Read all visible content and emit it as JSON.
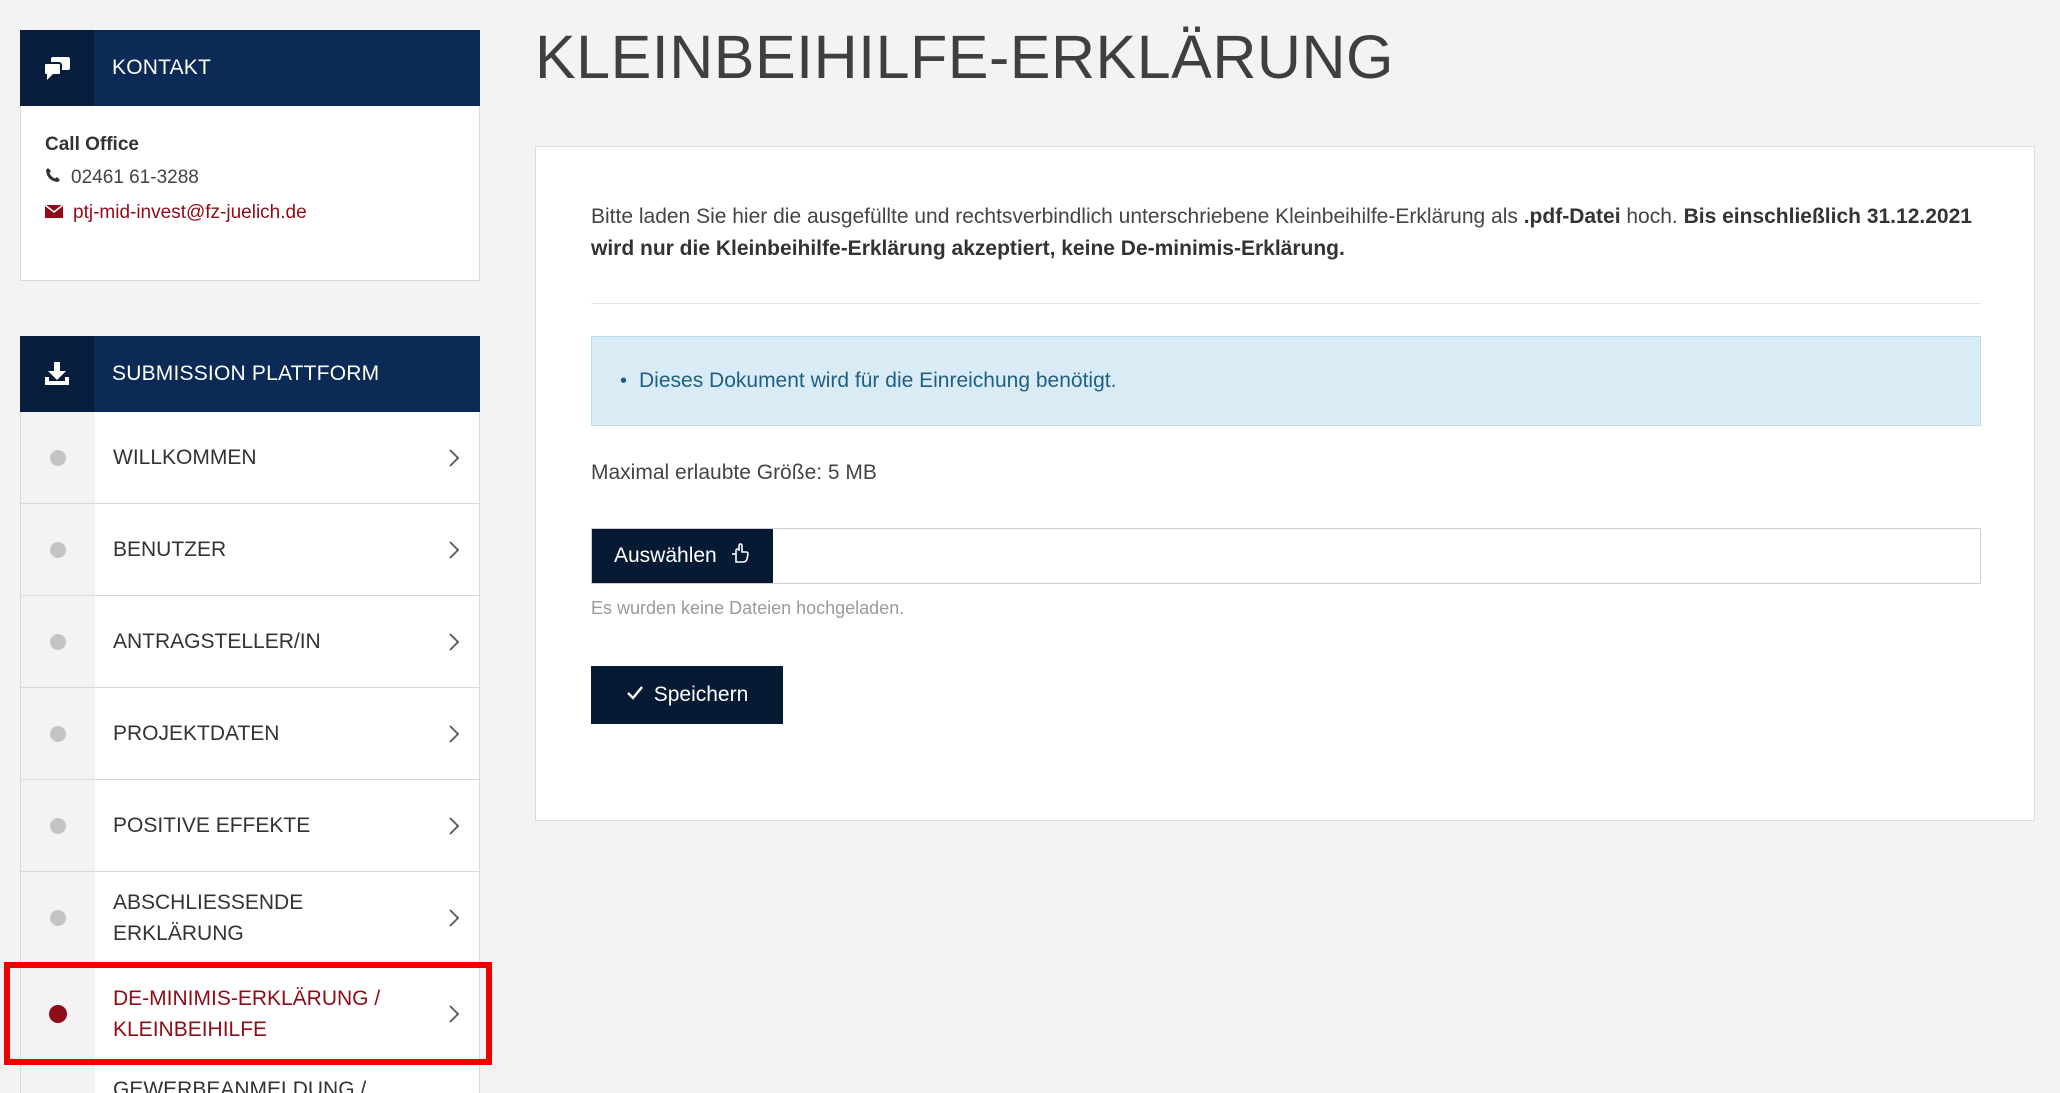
{
  "contact": {
    "header": "KONTAKT",
    "heading": "Call Office",
    "phone": "02461 61-3288",
    "email": "ptj-mid-invest@fz-juelich.de"
  },
  "submission": {
    "header": "SUBMISSION PLATTFORM",
    "items": [
      {
        "label": "WILLKOMMEN"
      },
      {
        "label": "BENUTZER"
      },
      {
        "label": "ANTRAGSTELLER/IN"
      },
      {
        "label": "PROJEKTDATEN"
      },
      {
        "label": "POSITIVE EFFEKTE"
      },
      {
        "label": "ABSCHLIESSENDE ERKLÄRUNG"
      },
      {
        "label": "DE-MINIMIS-ERKLÄRUNG / KLEINBEIHILFE",
        "active": true
      },
      {
        "label": "GEWERBEANMELDUNG /"
      }
    ]
  },
  "main": {
    "title": "KLEINBEIHILFE-ERKLÄRUNG",
    "intro_part1": "Bitte laden Sie hier die ausgefüllte und rechtsverbindlich unterschriebene Kleinbeihilfe-Erklärung als ",
    "intro_bold1": ".pdf-Datei",
    "intro_part2": " hoch. ",
    "intro_bold2": "Bis einschließlich 31.12.2021 wird nur die Kleinbeihilfe-Erklärung akzeptiert, keine De-minimis-Erklärung.",
    "info": "Dieses Dokument wird für die Einreichung benötigt.",
    "max_size": "Maximal erlaubte Größe: 5 MB",
    "choose_label": "Auswählen",
    "no_files": "Es wurden keine Dateien hochgeladen.",
    "save_label": "Speichern"
  },
  "colors": {
    "header_navy": "#0b2a55",
    "accent_red": "#8d0c17",
    "button_dark": "#071a33",
    "info_bg": "#d9ecf5",
    "highlight": "#f20000"
  }
}
